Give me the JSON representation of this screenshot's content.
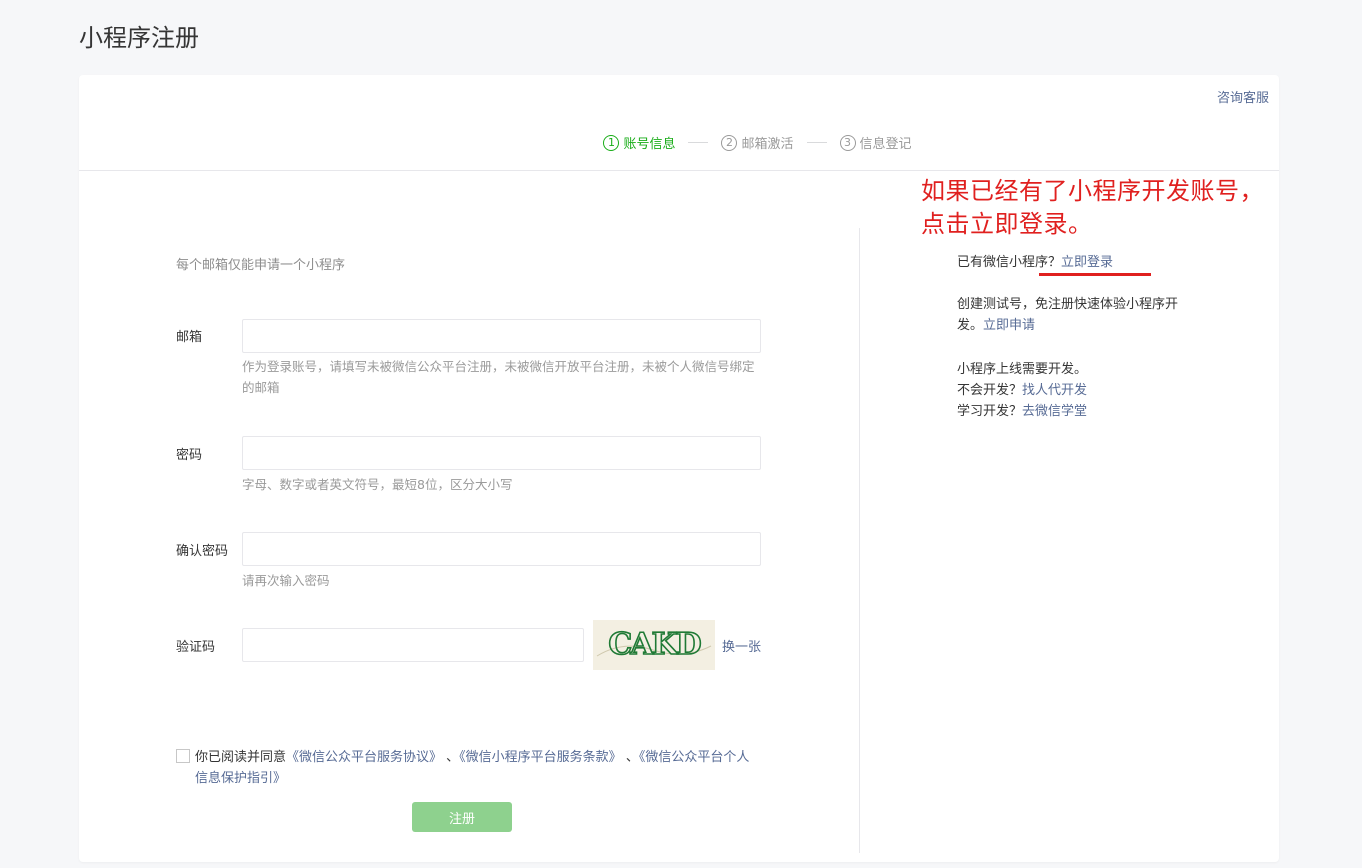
{
  "page": {
    "title": "小程序注册"
  },
  "header": {
    "consult_link": "咨询客服"
  },
  "steps": [
    {
      "num": "1",
      "label": "账号信息",
      "active": true
    },
    {
      "num": "2",
      "label": "邮箱激活",
      "active": false
    },
    {
      "num": "3",
      "label": "信息登记",
      "active": false
    }
  ],
  "form": {
    "tip": "每个邮箱仅能申请一个小程序",
    "email": {
      "label": "邮箱",
      "value": "",
      "hint": "作为登录账号，请填写未被微信公众平台注册，未被微信开放平台注册，未被个人微信号绑定的邮箱"
    },
    "password": {
      "label": "密码",
      "value": "",
      "hint": "字母、数字或者英文符号，最短8位，区分大小写"
    },
    "confirm_password": {
      "label": "确认密码",
      "value": "",
      "hint": "请再次输入密码"
    },
    "captcha": {
      "label": "验证码",
      "value": "",
      "image_text": "CAKD",
      "refresh": "换一张"
    },
    "agreement": {
      "prefix": "你已阅读并同意",
      "link1": "《微信公众平台服务协议》",
      "sep1": " 、",
      "link2": "《微信小程序平台服务条款》",
      "sep2": " 、",
      "link3": "《微信公众平台个人信息保护指引》",
      "checked": false
    },
    "submit": "注册"
  },
  "side": {
    "have_account": "已有微信小程序？",
    "login_link": "立即登录",
    "test_text": "创建测试号，免注册快速体验小程序开发。",
    "test_link": "立即申请",
    "dev_line1": "小程序上线需要开发。",
    "dev_line2_prefix": "不会开发？",
    "dev_line2_link": "找人代开发",
    "dev_line3_prefix": "学习开发？",
    "dev_line3_link": "去微信学堂"
  },
  "annotation": {
    "text": "如果已经有了小程序开发账号，点击立即登录。",
    "color": "#e0201f"
  },
  "colors": {
    "accent": "#1aad19",
    "link": "#576b95",
    "button_disabled": "#8ed18e"
  }
}
